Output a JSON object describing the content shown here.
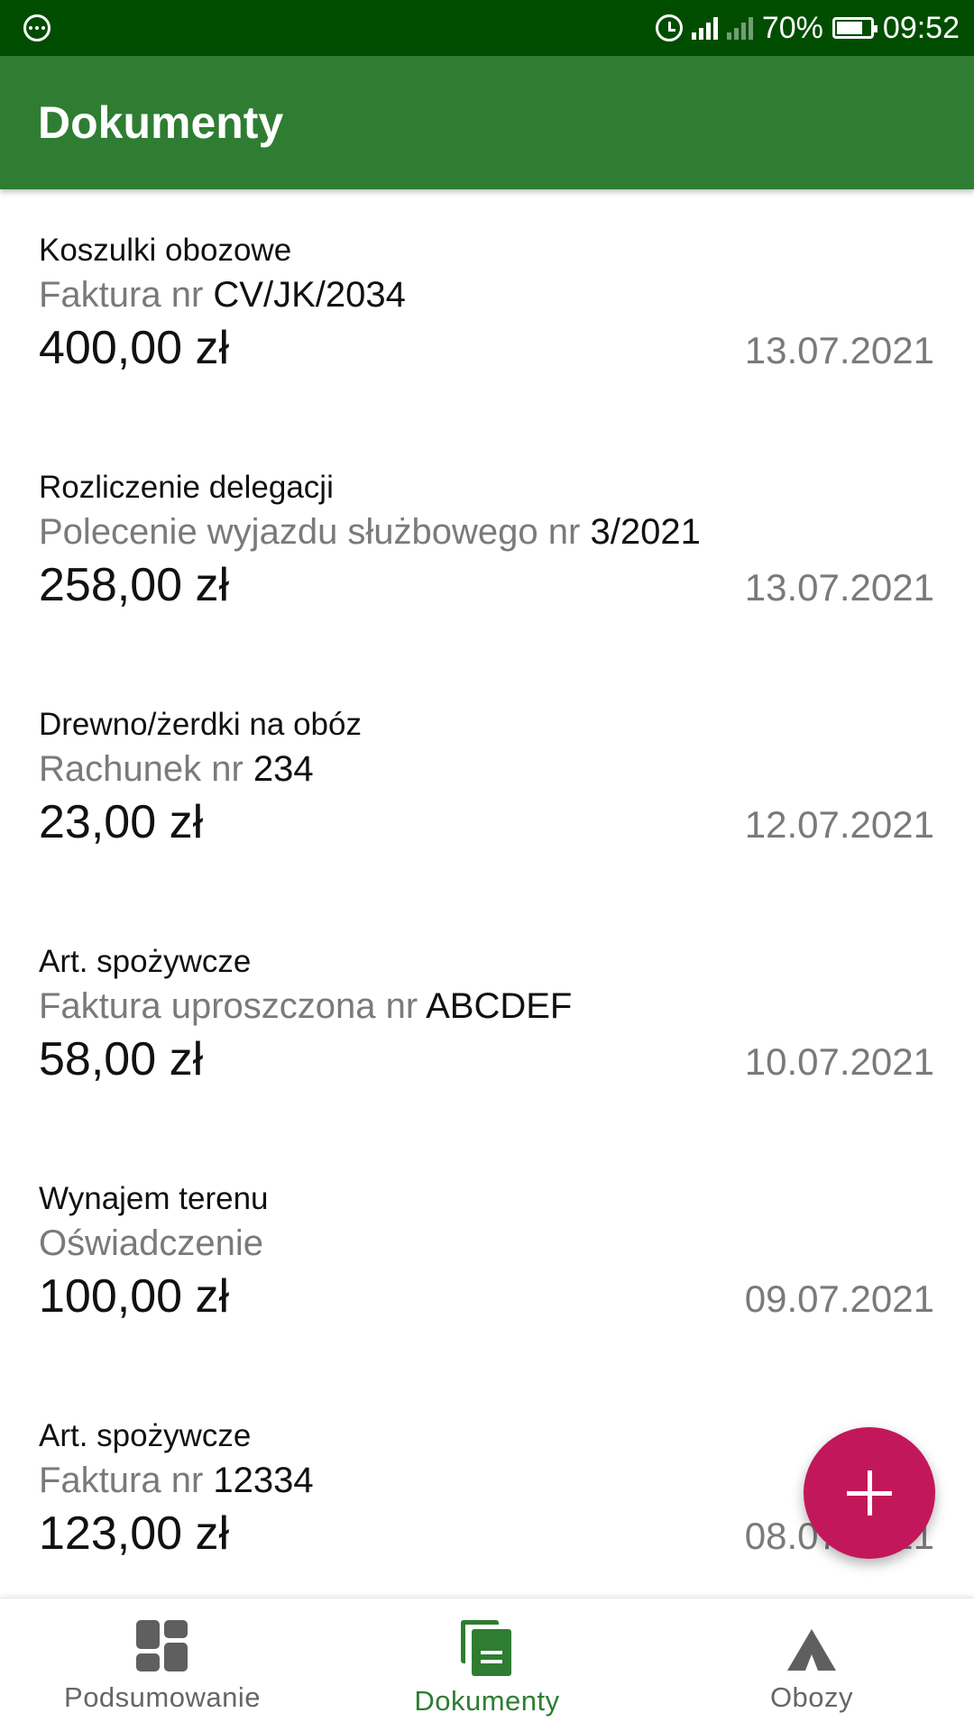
{
  "status_bar": {
    "battery": "70%",
    "time": "09:52"
  },
  "app_bar": {
    "title": "Dokumenty"
  },
  "documents": [
    {
      "title": "Koszulki obozowe",
      "type": "Faktura nr",
      "number": "CV/JK/2034",
      "amount": "400,00 zł",
      "date": "13.07.2021"
    },
    {
      "title": "Rozliczenie delegacji",
      "type": "Polecenie wyjazdu służbowego nr",
      "number": "3/2021",
      "amount": "258,00 zł",
      "date": "13.07.2021"
    },
    {
      "title": "Drewno/żerdki na obóz",
      "type": "Rachunek nr",
      "number": "234",
      "amount": "23,00 zł",
      "date": "12.07.2021"
    },
    {
      "title": "Art. spożywcze",
      "type": "Faktura uproszczona nr",
      "number": "ABCDEF",
      "amount": "58,00 zł",
      "date": "10.07.2021"
    },
    {
      "title": "Wynajem terenu",
      "type": "Oświadczenie",
      "number": "",
      "amount": "100,00 zł",
      "date": "09.07.2021"
    },
    {
      "title": "Art. spożywcze",
      "type": "Faktura nr",
      "number": "12334",
      "amount": "123,00 zł",
      "date": "08.07.2021"
    }
  ],
  "fab": {
    "icon": "plus-icon",
    "color": "#c2185b"
  },
  "bottom_nav": {
    "active": "Dokumenty",
    "items": [
      {
        "label": "Podsumowanie",
        "icon": "dashboard-icon"
      },
      {
        "label": "Dokumenty",
        "icon": "documents-icon"
      },
      {
        "label": "Obozy",
        "icon": "tent-icon"
      }
    ]
  },
  "colors": {
    "status_bar": "#004d00",
    "primary": "#2e7d32",
    "accent": "#c2185b",
    "secondary_text": "#7a7a7a"
  }
}
